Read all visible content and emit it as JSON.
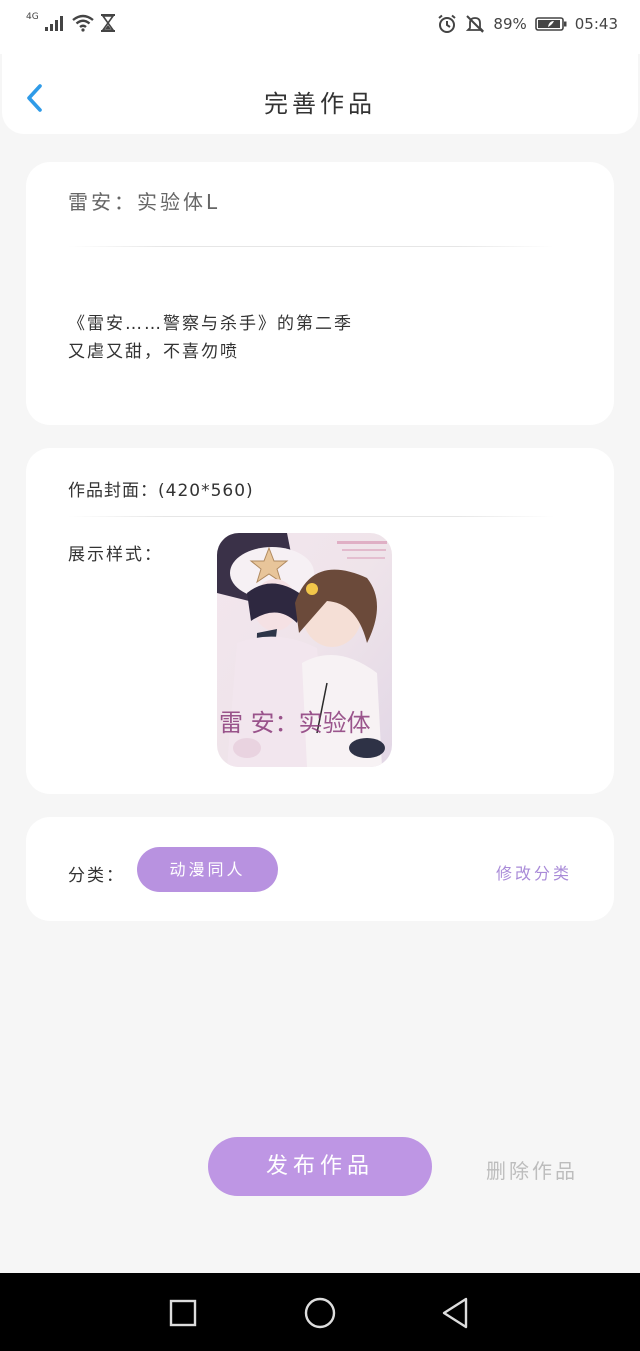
{
  "status_bar": {
    "network": "4G",
    "battery_percent": "89%",
    "time": "05:43",
    "icons": [
      "signal-icon",
      "wifi-icon",
      "hourglass-icon",
      "alarm-icon",
      "mute-icon",
      "battery-icon"
    ]
  },
  "header": {
    "title": "完善作品",
    "back_icon": "chevron-left-icon"
  },
  "work": {
    "title": "雷安：实验体L",
    "description_line1": "《雷安……警察与杀手》的第二季",
    "description_line2": "又虐又甜，不喜勿喷"
  },
  "cover": {
    "label": "作品封面：(420*560)",
    "style_label": "展示样式："
  },
  "category": {
    "label": "分类：",
    "value": "动漫同人",
    "edit_label": "修改分类"
  },
  "actions": {
    "publish_label": "发布作品",
    "delete_label": "删除作品"
  },
  "colors": {
    "accent": "#be96e4",
    "accent_text": "#a98bd8",
    "back_arrow": "#2f9be8",
    "background": "#f6f6f6"
  },
  "nav_bar": {
    "icons": [
      "recent-apps-icon",
      "home-icon",
      "back-triangle-icon"
    ]
  }
}
